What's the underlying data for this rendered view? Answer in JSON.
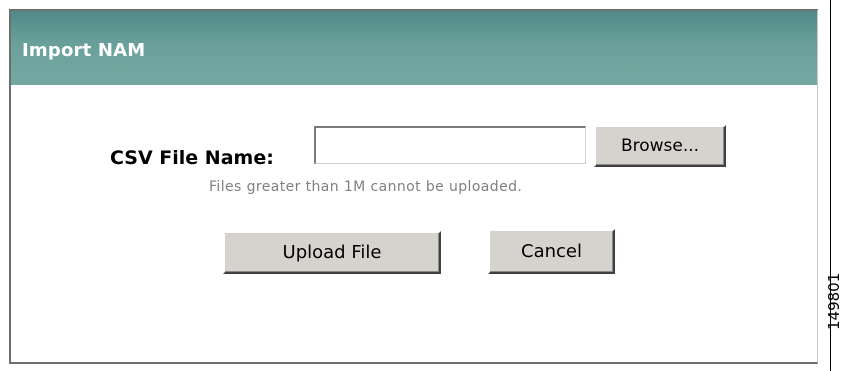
{
  "dialog": {
    "title": "Import NAM",
    "file_field": {
      "label": "CSV File Name:",
      "value": "",
      "placeholder": ""
    },
    "browse_label": "Browse...",
    "hint": "Files greater than 1M cannot be uploaded.",
    "upload_label": "Upload File",
    "cancel_label": "Cancel"
  },
  "figure_id": "149801",
  "colors": {
    "titlebar": "#6aa09b",
    "button_face": "#d6d3ce",
    "hint_text": "#808080"
  }
}
